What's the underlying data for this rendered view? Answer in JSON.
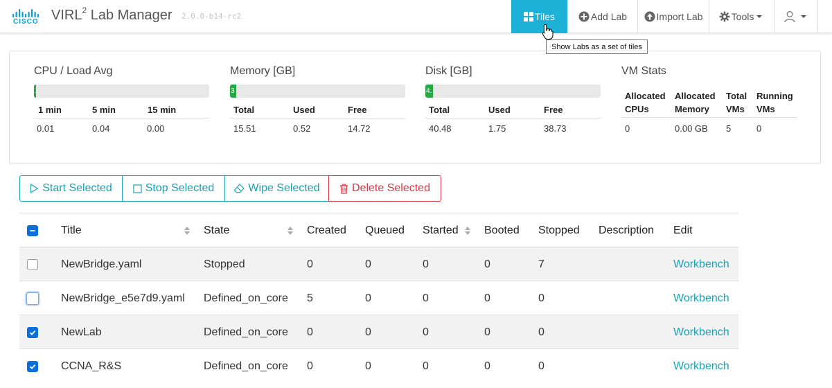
{
  "header": {
    "brand_name": "VIRL",
    "brand_sup": "2",
    "brand_rest": " Lab Manager",
    "logo_text": "CISCO",
    "version": "2.0.0-b14-rc2",
    "nav": {
      "tiles": "Tiles",
      "add_lab": "Add Lab",
      "import_lab": "Import Lab",
      "tools": "Tools"
    },
    "tooltip": "Show Labs as a set of tiles",
    "active_color": "#1eb1d8"
  },
  "stats": {
    "cpu": {
      "title": "CPU / Load Avg",
      "bar_label": "1",
      "bar_fraction": 0.01,
      "cols": [
        "1 min",
        "5 min",
        "15 min"
      ],
      "vals": [
        "0.01",
        "0.04",
        "0.00"
      ]
    },
    "memory": {
      "title": "Memory [GB]",
      "bar_label": "3",
      "bar_fraction": 0.034,
      "cols": [
        "Total",
        "Used",
        "Free"
      ],
      "vals": [
        "15.51",
        "0.52",
        "14.72"
      ]
    },
    "disk": {
      "title": "Disk [GB]",
      "bar_label": "4.",
      "bar_fraction": 0.043,
      "cols": [
        "Total",
        "Used",
        "Free"
      ],
      "vals": [
        "40.48",
        "1.75",
        "38.73"
      ]
    },
    "vm": {
      "title": "VM Stats",
      "cols": [
        {
          "l1": "Allocated",
          "l2": "CPUs"
        },
        {
          "l1": "Allocated",
          "l2": "Memory"
        },
        {
          "l1": "Total",
          "l2": "VMs"
        },
        {
          "l1": "Running",
          "l2": "VMs"
        }
      ],
      "vals": [
        "0",
        "0.00 GB",
        "5",
        "0"
      ]
    },
    "bar_color": "#28a745"
  },
  "actions": {
    "start": "Start Selected",
    "stop": "Stop Selected",
    "wipe": "Wipe Selected",
    "delete": "Delete Selected",
    "primary_color": "#17a2b8",
    "danger_color": "#dc3545"
  },
  "table": {
    "columns": {
      "title": "Title",
      "state": "State",
      "created": "Created",
      "queued": "Queued",
      "started": "Started",
      "booted": "Booted",
      "stopped": "Stopped",
      "description": "Description",
      "edit": "Edit"
    },
    "rows": [
      {
        "checked": false,
        "title": "NewBridge.yaml",
        "state": "Stopped",
        "created": "0",
        "queued": "0",
        "started": "0",
        "booted": "0",
        "stopped": "7",
        "description": "",
        "edit": "Workbench"
      },
      {
        "checked": false,
        "title": "NewBridge_e5e7d9.yaml",
        "state": "Defined_on_core",
        "created": "5",
        "queued": "0",
        "started": "0",
        "booted": "0",
        "stopped": "0",
        "description": "",
        "edit": "Workbench"
      },
      {
        "checked": true,
        "title": "NewLab",
        "state": "Defined_on_core",
        "created": "0",
        "queued": "0",
        "started": "0",
        "booted": "0",
        "stopped": "0",
        "description": "",
        "edit": "Workbench"
      },
      {
        "checked": true,
        "title": "CCNA_R&S",
        "state": "Defined_on_core",
        "created": "0",
        "queued": "0",
        "started": "0",
        "booted": "0",
        "stopped": "0",
        "description": "",
        "edit": "Workbench"
      }
    ]
  }
}
